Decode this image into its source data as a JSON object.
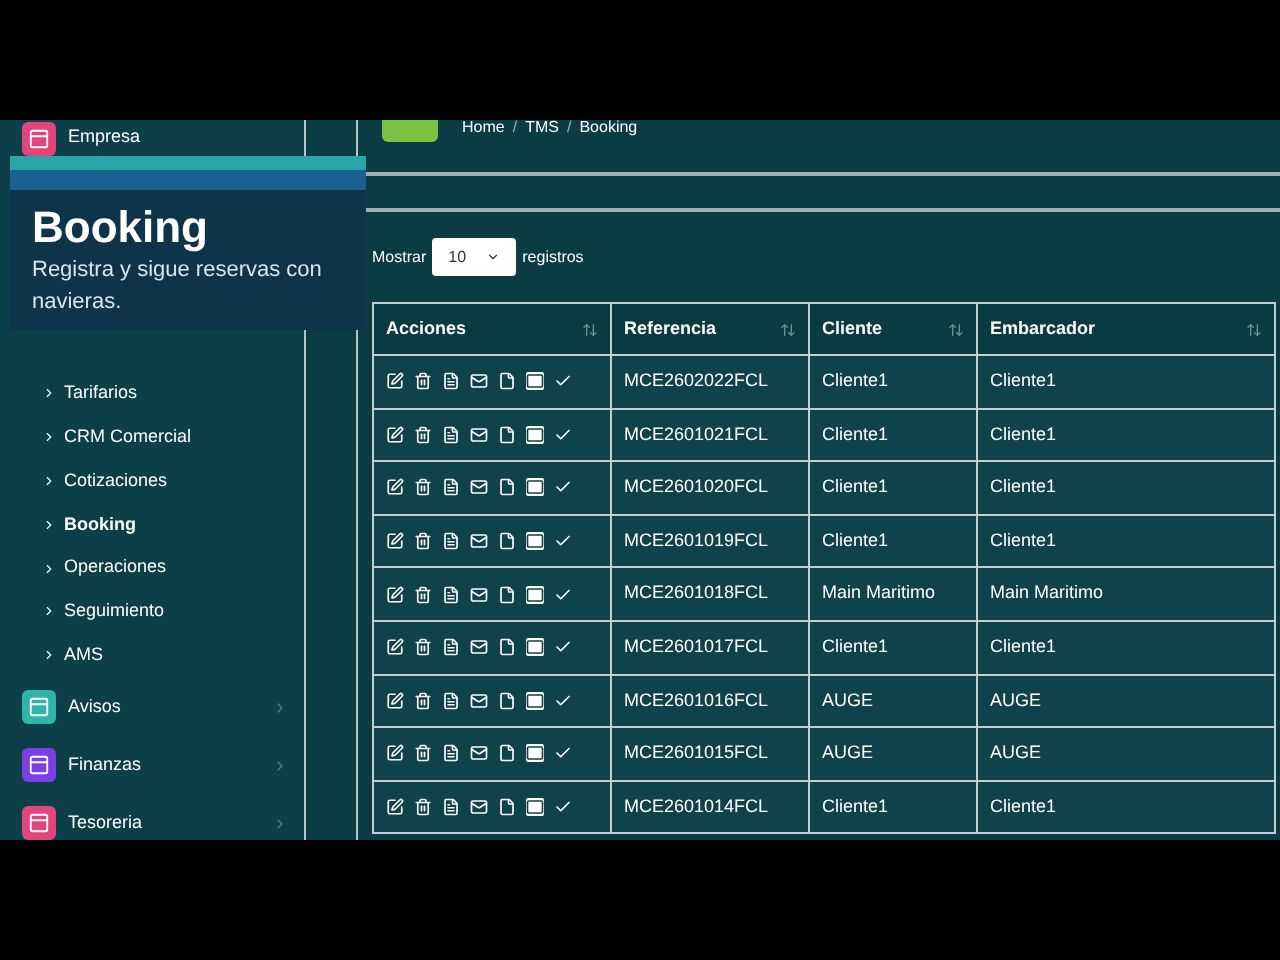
{
  "overlay": {
    "title": "Booking",
    "subtitle": "Registra y sigue reservas con navieras."
  },
  "sidebar": {
    "top_item": {
      "label": "Empresa",
      "color": "#e0457b"
    },
    "sub_items": [
      {
        "label": "Tarifarios",
        "selected": false
      },
      {
        "label": "CRM Comercial",
        "selected": false
      },
      {
        "label": "Cotizaciones",
        "selected": false
      },
      {
        "label": "Booking",
        "selected": true
      },
      {
        "label": "Operaciones",
        "selected": false
      },
      {
        "label": "Seguimiento",
        "selected": false
      },
      {
        "label": "AMS",
        "selected": false
      }
    ],
    "items": [
      {
        "label": "Avisos",
        "color": "#2fb5a8"
      },
      {
        "label": "Finanzas",
        "color": "#7b3fe4"
      },
      {
        "label": "Tesoreria",
        "color": "#e0457b"
      }
    ]
  },
  "breadcrumb": {
    "separator": "/",
    "items": [
      "Home",
      "TMS",
      "Booking"
    ]
  },
  "length_menu": {
    "before": "Mostrar",
    "value": "10",
    "after": "registros"
  },
  "table": {
    "columns": [
      "Acciones",
      "Referencia",
      "Cliente",
      "Embarcador"
    ],
    "rows": [
      [
        "",
        "MCE2602022FCL",
        "Cliente1",
        "Cliente1"
      ],
      [
        "",
        "MCE2601021FCL",
        "Cliente1",
        "Cliente1"
      ],
      [
        "",
        "MCE2601020FCL",
        "Cliente1",
        "Cliente1"
      ],
      [
        "",
        "MCE2601019FCL",
        "Cliente1",
        "Cliente1"
      ],
      [
        "",
        "MCE2601018FCL",
        "Main Maritimo",
        "Main Maritimo"
      ],
      [
        "",
        "MCE2601017FCL",
        "Cliente1",
        "Cliente1"
      ],
      [
        "",
        "MCE2601016FCL",
        "AUGE",
        "AUGE"
      ],
      [
        "",
        "MCE2601015FCL",
        "AUGE",
        "AUGE"
      ],
      [
        "",
        "MCE2601014FCL",
        "Cliente1",
        "Cliente1"
      ]
    ]
  }
}
